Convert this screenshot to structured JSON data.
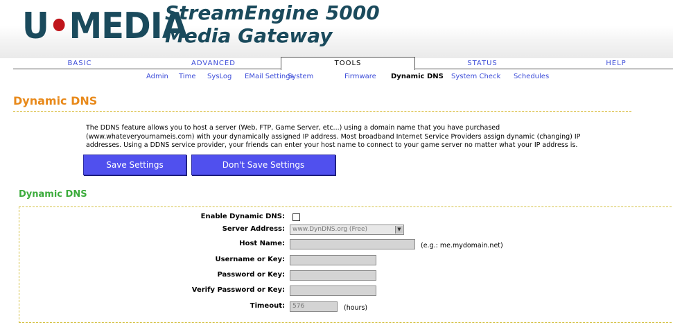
{
  "header": {
    "logo_left": "U",
    "logo_dash": "•",
    "logo_right": "MEDIA",
    "product_line1": "StreamEngine 5000",
    "product_line2": "Media Gateway"
  },
  "tabs": [
    {
      "label": "BASIC",
      "active": false
    },
    {
      "label": "ADVANCED",
      "active": false
    },
    {
      "label": "TOOLS",
      "active": true
    },
    {
      "label": "STATUS",
      "active": false
    },
    {
      "label": "HELP",
      "active": false
    }
  ],
  "subnav": [
    {
      "label": "Admin"
    },
    {
      "label": "Time"
    },
    {
      "label": "SysLog"
    },
    {
      "label": "EMail Settings"
    },
    {
      "label": "System"
    },
    {
      "label": "Firmware"
    },
    {
      "label": "Dynamic DNS",
      "active": true
    },
    {
      "label": "System Check"
    },
    {
      "label": "Schedules"
    }
  ],
  "page": {
    "title": "Dynamic DNS",
    "intro_line1": "The DDNS feature allows you to host a server (Web, FTP, Game Server, etc...) using a domain name that you have purchased",
    "intro_line2": "(www.whateveryournameis.com) with your dynamically assigned IP address. Most broadband Internet Service Providers assign dynamic (changing) IP",
    "intro_line3": "addresses. Using a DDNS service provider, your friends can enter your host name to connect to your game server no matter what your IP address is.",
    "save_label": "Save Settings",
    "dont_save_label": "Don't Save Settings"
  },
  "section": {
    "title": "Dynamic DNS",
    "enable_label": "Enable Dynamic DNS:",
    "enable_checked": false,
    "server_label": "Server Address:",
    "server_value": "www.DynDNS.org (Free)",
    "host_label": "Host Name:",
    "host_value": "",
    "host_hint": "(e.g.: me.mydomain.net)",
    "username_label": "Username or Key:",
    "username_value": "",
    "password_label": "Password or Key:",
    "password_value": "",
    "verify_label": "Verify Password or Key:",
    "verify_value": "",
    "timeout_label": "Timeout:",
    "timeout_value": "576",
    "timeout_hint": "(hours)"
  },
  "colors": {
    "accent_orange": "#e8891a",
    "section_green": "#3cac3c",
    "link_blue": "#3b4bd8",
    "button_blue": "#5050ee",
    "logo_teal": "#1a4a5c",
    "logo_red": "#c0161c"
  }
}
